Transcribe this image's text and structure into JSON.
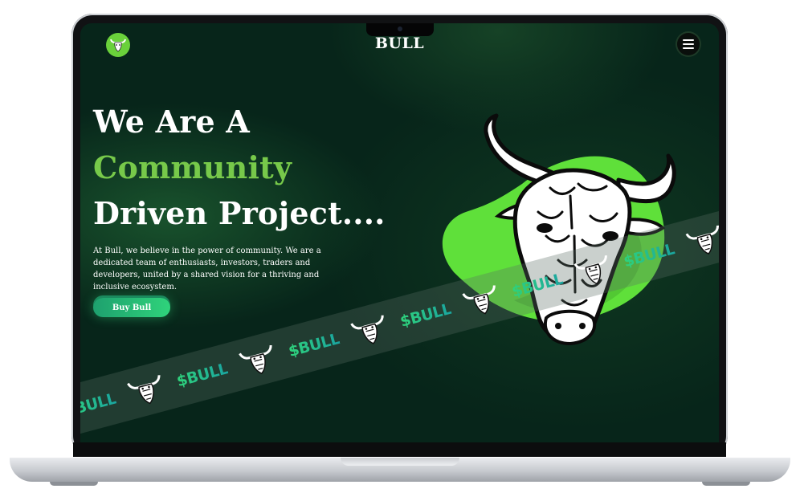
{
  "header": {
    "brand": "BULL",
    "logo_icon": "bull-head-icon",
    "menu_icon": "hamburger-menu-icon"
  },
  "hero": {
    "line1": "We Are A",
    "line2": "Community",
    "line3": "Driven Project....",
    "description": "At Bull, we believe in the power of community. We are a dedicated team of enthusiasts, investors, traders and developers, united by a shared vision for a thriving and inclusive ecosystem.",
    "cta_label": "Buy Bull"
  },
  "ribbon": {
    "token_label": "$BULL",
    "icon": "bull-head-icon"
  },
  "colors": {
    "background": "#07251a",
    "accent_green": "#77c94a",
    "blob_green": "#5fe03a",
    "button_gradient_start": "#1ea06e",
    "button_gradient_end": "#2fd37b"
  }
}
